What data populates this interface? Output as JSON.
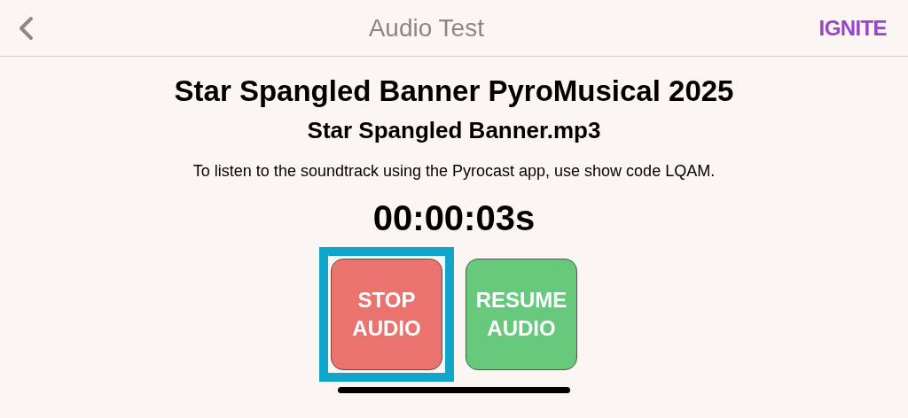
{
  "header": {
    "title": "Audio Test",
    "logo": "IGNITE"
  },
  "show": {
    "title": "Star Spangled Banner PyroMusical 2025",
    "file": "Star Spangled Banner.mp3",
    "note": "To listen to the soundtrack using the Pyrocast app, use show code LQAM.",
    "timer": "00:00:03s"
  },
  "buttons": [
    {
      "kind": "stop",
      "lines": [
        "STOP",
        "AUDIO"
      ],
      "selected": true
    },
    {
      "kind": "resume",
      "lines": [
        "RESUME",
        "AUDIO"
      ],
      "selected": false
    }
  ]
}
